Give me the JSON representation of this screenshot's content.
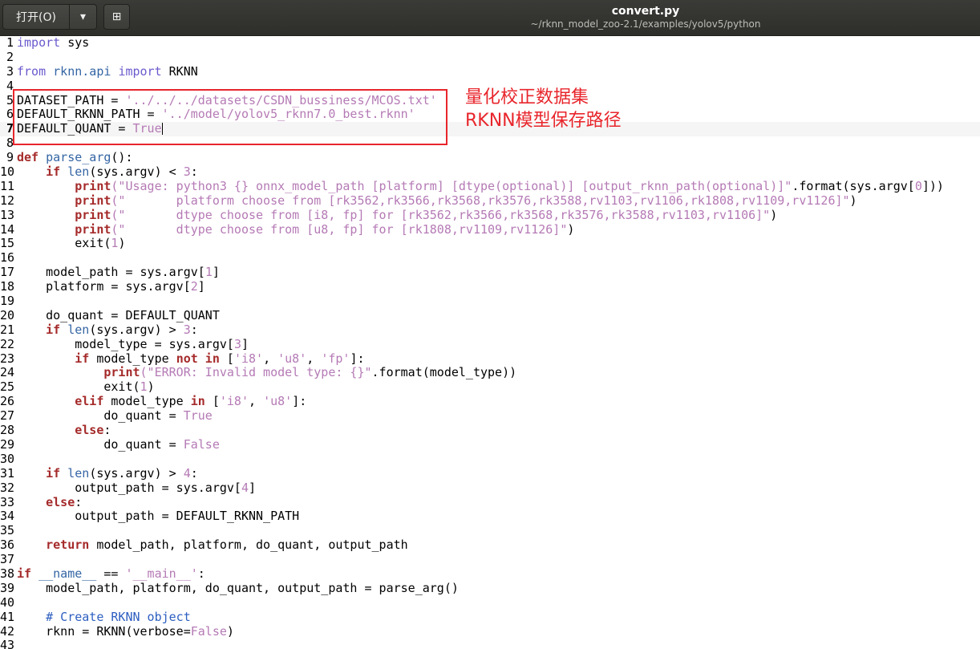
{
  "titlebar": {
    "open_label": "打开(O)",
    "dropdown_icon": "▾",
    "new_icon": "⊞",
    "filename": "convert.py",
    "path": "~/rknn_model_zoo-2.1/examples/yolov5/python"
  },
  "annotations": {
    "dataset_label": "量化校正数据集",
    "rknn_label": "RKNN模型保存路径",
    "color": "#e8262c"
  },
  "editor": {
    "current_line": 7,
    "lines": [
      [
        [
          "",
          "import"
        ],
        [
          "n",
          " sys"
        ]
      ],
      [],
      [
        [
          "kw2",
          "from"
        ],
        [
          "n",
          " "
        ],
        [
          "bi",
          "rknn.api"
        ],
        [
          "n",
          " "
        ],
        [
          "kw2",
          "import"
        ],
        [
          "n",
          " RKNN"
        ]
      ],
      [],
      [
        [
          "n",
          "DATASET_PATH = "
        ],
        [
          "st",
          "'../../../datasets/CSDN_bussiness/MCOS.txt'"
        ]
      ],
      [
        [
          "n",
          "DEFAULT_RKNN_PATH = "
        ],
        [
          "st",
          "'../model/yolov5_rknn7.0_best.rknn'"
        ]
      ],
      [
        [
          "n",
          "DEFAULT_QUANT = "
        ],
        [
          "nm",
          "True"
        ]
      ],
      [],
      [
        [
          "kw",
          "def"
        ],
        [
          "n",
          " "
        ],
        [
          "bi",
          "parse_arg"
        ],
        [
          "n",
          "():"
        ]
      ],
      [
        [
          "n",
          "    "
        ],
        [
          "kw",
          "if"
        ],
        [
          "n",
          " "
        ],
        [
          "bi",
          "len"
        ],
        [
          "n",
          "(sys.argv) < "
        ],
        [
          "nm",
          "3"
        ],
        [
          "n",
          ":"
        ]
      ],
      [
        [
          "n",
          "        "
        ],
        [
          "kw",
          "print"
        ],
        [
          "st",
          "(\"Usage: python3 {} onnx_model_path [platform] [dtype(optional)] [output_rknn_path(optional)]\""
        ],
        [
          "n",
          ".format(sys.argv["
        ],
        [
          "nm",
          "0"
        ],
        [
          "n",
          "]))"
        ]
      ],
      [
        [
          "n",
          "        "
        ],
        [
          "kw",
          "print"
        ],
        [
          "st",
          "(\"       platform choose from [rk3562,rk3566,rk3568,rk3576,rk3588,rv1103,rv1106,rk1808,rv1109,rv1126]\""
        ],
        [
          "n",
          ")"
        ]
      ],
      [
        [
          "n",
          "        "
        ],
        [
          "kw",
          "print"
        ],
        [
          "st",
          "(\"       dtype choose from [i8, fp] for [rk3562,rk3566,rk3568,rk3576,rk3588,rv1103,rv1106]\""
        ],
        [
          "n",
          ")"
        ]
      ],
      [
        [
          "n",
          "        "
        ],
        [
          "kw",
          "print"
        ],
        [
          "st",
          "(\"       dtype choose from [u8, fp] for [rk1808,rv1109,rv1126]\""
        ],
        [
          "n",
          ")"
        ]
      ],
      [
        [
          "n",
          "        exit("
        ],
        [
          "nm",
          "1"
        ],
        [
          "n",
          ")"
        ]
      ],
      [],
      [
        [
          "n",
          "    model_path = sys.argv["
        ],
        [
          "nm",
          "1"
        ],
        [
          "n",
          "]"
        ]
      ],
      [
        [
          "n",
          "    platform = sys.argv["
        ],
        [
          "nm",
          "2"
        ],
        [
          "n",
          "]"
        ]
      ],
      [],
      [
        [
          "n",
          "    do_quant = DEFAULT_QUANT"
        ]
      ],
      [
        [
          "n",
          "    "
        ],
        [
          "kw",
          "if"
        ],
        [
          "n",
          " "
        ],
        [
          "bi",
          "len"
        ],
        [
          "n",
          "(sys.argv) > "
        ],
        [
          "nm",
          "3"
        ],
        [
          "n",
          ":"
        ]
      ],
      [
        [
          "n",
          "        model_type = sys.argv["
        ],
        [
          "nm",
          "3"
        ],
        [
          "n",
          "]"
        ]
      ],
      [
        [
          "n",
          "        "
        ],
        [
          "kw",
          "if"
        ],
        [
          "n",
          " model_type "
        ],
        [
          "kw",
          "not in"
        ],
        [
          "n",
          " ["
        ],
        [
          "st",
          "'i8'"
        ],
        [
          "n",
          ", "
        ],
        [
          "st",
          "'u8'"
        ],
        [
          "n",
          ", "
        ],
        [
          "st",
          "'fp'"
        ],
        [
          "n",
          "]:"
        ]
      ],
      [
        [
          "n",
          "            "
        ],
        [
          "kw",
          "print"
        ],
        [
          "st",
          "(\"ERROR: Invalid model type: {}\""
        ],
        [
          "n",
          ".format(model_type))"
        ]
      ],
      [
        [
          "n",
          "            exit("
        ],
        [
          "nm",
          "1"
        ],
        [
          "n",
          ")"
        ]
      ],
      [
        [
          "n",
          "        "
        ],
        [
          "kw",
          "elif"
        ],
        [
          "n",
          " model_type "
        ],
        [
          "kw",
          "in"
        ],
        [
          "n",
          " ["
        ],
        [
          "st",
          "'i8'"
        ],
        [
          "n",
          ", "
        ],
        [
          "st",
          "'u8'"
        ],
        [
          "n",
          "]:"
        ]
      ],
      [
        [
          "n",
          "            do_quant = "
        ],
        [
          "nm",
          "True"
        ]
      ],
      [
        [
          "n",
          "        "
        ],
        [
          "kw",
          "else"
        ],
        [
          "n",
          ":"
        ]
      ],
      [
        [
          "n",
          "            do_quant = "
        ],
        [
          "nm",
          "False"
        ]
      ],
      [],
      [
        [
          "n",
          "    "
        ],
        [
          "kw",
          "if"
        ],
        [
          "n",
          " "
        ],
        [
          "bi",
          "len"
        ],
        [
          "n",
          "(sys.argv) > "
        ],
        [
          "nm",
          "4"
        ],
        [
          "n",
          ":"
        ]
      ],
      [
        [
          "n",
          "        output_path = sys.argv["
        ],
        [
          "nm",
          "4"
        ],
        [
          "n",
          "]"
        ]
      ],
      [
        [
          "n",
          "    "
        ],
        [
          "kw",
          "else"
        ],
        [
          "n",
          ":"
        ]
      ],
      [
        [
          "n",
          "        output_path = DEFAULT_RKNN_PATH"
        ]
      ],
      [],
      [
        [
          "n",
          "    "
        ],
        [
          "kw",
          "return"
        ],
        [
          "n",
          " model_path, platform, do_quant, output_path"
        ]
      ],
      [],
      [
        [
          "kw",
          "if"
        ],
        [
          "n",
          " "
        ],
        [
          "bi",
          "__name__"
        ],
        [
          "n",
          " == "
        ],
        [
          "st",
          "'__main__'"
        ],
        [
          "n",
          ":"
        ]
      ],
      [
        [
          "n",
          "    model_path, platform, do_quant, output_path = parse_arg()"
        ]
      ],
      [],
      [
        [
          "n",
          "    "
        ],
        [
          "cm",
          "# Create RKNN object"
        ]
      ],
      [
        [
          "n",
          "    rknn = RKNN(verbose="
        ],
        [
          "nm",
          "False"
        ],
        [
          "n",
          ")"
        ]
      ],
      []
    ]
  }
}
